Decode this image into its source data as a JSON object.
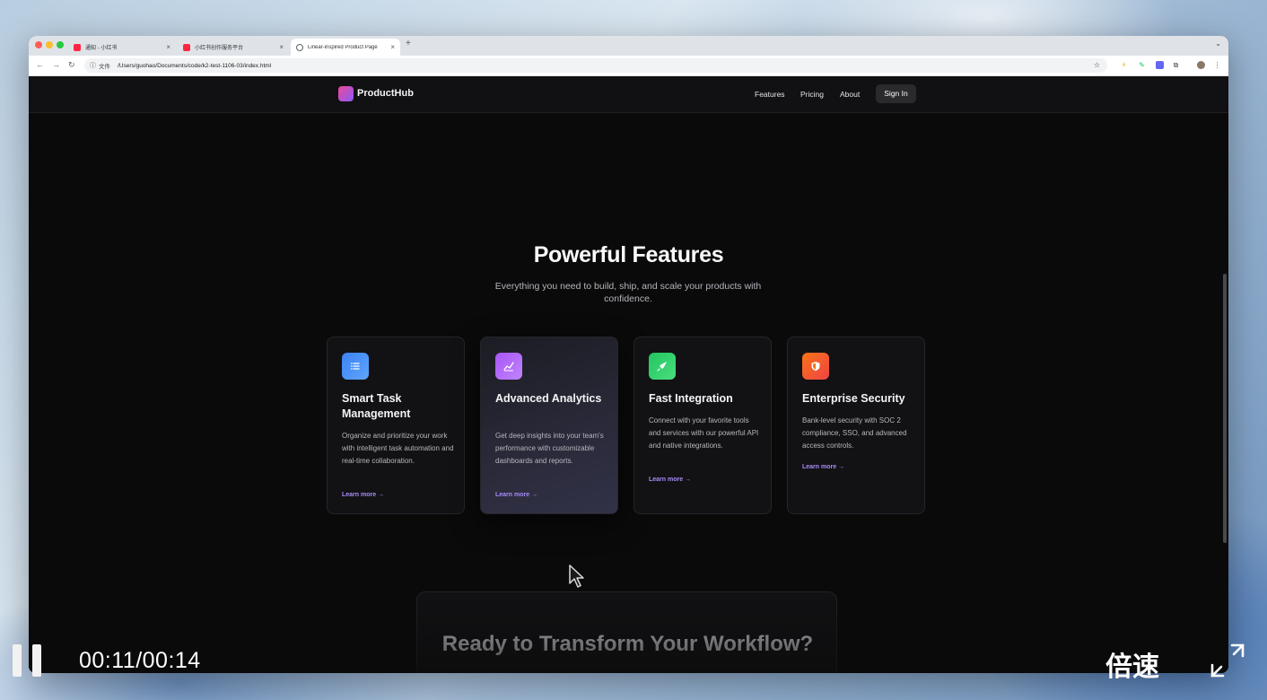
{
  "browser": {
    "tabs": [
      {
        "title": "通知 - 小红书",
        "favicon_color": "#ff2442",
        "active": false
      },
      {
        "title": "小红书创作服务平台",
        "favicon_color": "#ff2442",
        "active": false
      },
      {
        "title": "Linear-inspired Product Page",
        "favicon_color": "#5f6368",
        "active": true
      }
    ],
    "new_tab_icon": "+",
    "address": {
      "scheme_label": "文件",
      "url": "/Users/guohao/Documents/code/k2-test-1106-03/index.html"
    }
  },
  "site": {
    "brand": "ProductHub",
    "nav": [
      "Features",
      "Pricing",
      "About"
    ],
    "signin": "Sign In"
  },
  "features": {
    "title": "Powerful Features",
    "subtitle": "Everything you need to build, ship, and scale your products with confidence.",
    "cards": [
      {
        "title": "Smart Task Management",
        "description": "Organize and prioritize your work with intelligent task automation and real-time collaboration.",
        "link": "Learn more →",
        "icon": "list-icon",
        "color": "#3b82f6"
      },
      {
        "title": "Advanced Analytics",
        "description": "Get deep insights into your team's performance with customizable dashboards and reports.",
        "link": "Learn more →",
        "icon": "chart-icon",
        "color": "#a855f7"
      },
      {
        "title": "Fast Integration",
        "description": "Connect with your favorite tools and services with our powerful API and native integrations.",
        "link": "Learn more →",
        "icon": "rocket-icon",
        "color": "#22c55e"
      },
      {
        "title": "Enterprise Security",
        "description": "Bank-level security with SOC 2 compliance, SSO, and advanced access controls.",
        "link": "Learn more →",
        "icon": "shield-icon",
        "color": "#f97316"
      }
    ]
  },
  "cta": {
    "title": "Ready to Transform Your Workflow?"
  },
  "video": {
    "time": "00:11/00:14",
    "speed_label": "倍速"
  }
}
